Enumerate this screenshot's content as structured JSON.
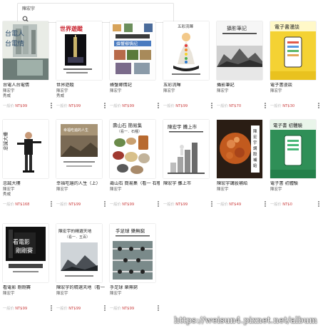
{
  "search": {
    "query": "陳宏宇",
    "icon": "search-icon"
  },
  "books": [
    {
      "title": "台電人台電情",
      "author": "陳宏宇",
      "publisher": "秀威",
      "price_label": "一般价",
      "price": "NT$99",
      "cover_text": [
        "台電人",
        "台電情"
      ]
    },
    {
      "title": "世界遊蹤",
      "author": "陳宏宇",
      "publisher": "秀威",
      "price_label": "一般价",
      "price": "NT$99",
      "cover_text": [
        "世界遊蹤"
      ]
    },
    {
      "title": "蜂蟹鄉情記",
      "author": "陳宏宇",
      "publisher": "",
      "price_label": "一般价",
      "price": "NT$99",
      "cover_text": [
        "蜂蟹鄉情記"
      ]
    },
    {
      "title": "五彩流暉",
      "author": "陳宏宇",
      "publisher": "",
      "price_label": "一般价",
      "price": "NT$99",
      "cover_text": [
        "五彩流暉"
      ]
    },
    {
      "title": "攝影筆記",
      "author": "陳宏宇",
      "publisher": "",
      "price_label": "一般价",
      "price": "NT$70",
      "cover_text": [
        "攝影筆記"
      ]
    },
    {
      "title": "電子書漫談",
      "author": "陳宏宇",
      "publisher": "",
      "price_label": "一般价",
      "price": "NT$30",
      "cover_text": [
        "電子書漫談"
      ]
    },
    {
      "title": "忠誠大樓",
      "author": "陳宏宇",
      "publisher": "秀威",
      "price_label": "一般价",
      "price": "NT$168",
      "cover_text": [
        "忠誠大樓"
      ]
    },
    {
      "title": "幸福吃遍的人生（上）",
      "author": "陳宏宇",
      "publisher": "",
      "price_label": "一般价",
      "price": "NT$99",
      "cover_text": [
        "幸福吃遍的人生"
      ]
    },
    {
      "title": "壽山石 簡易集（看一 石種）",
      "author": "陳宏宇",
      "publisher": "",
      "price_label": "一般价",
      "price": "NT$99",
      "cover_text": [
        "壽山石 簡易集",
        "（看一．石種）"
      ]
    },
    {
      "title": "陳宏宇 攤上市",
      "author": "",
      "publisher": "",
      "price_label": "一般价",
      "price": "NT$99",
      "cover_text": [
        "陳宏宇 攤上市"
      ]
    },
    {
      "title": "陳宏宇講股補給",
      "author": "陳宏宇",
      "publisher": "",
      "price_label": "一般价",
      "price": "NT$49",
      "cover_text": [
        "陳宏宇講股補給"
      ]
    },
    {
      "title": "電子書 初體驗",
      "author": "陳宏宇",
      "publisher": "",
      "price_label": "一般价",
      "price": "NT$0",
      "cover_text": [
        "電子書 初體驗"
      ]
    },
    {
      "title": "看電影 剛剛賽",
      "author": "陳宏宇",
      "publisher": "",
      "price_label": "一般价",
      "price": "NT$99",
      "cover_text": [
        "看電影",
        "剛剛賽"
      ]
    },
    {
      "title": "陳宏宇的精選天地（看一 五百）",
      "author": "陳宏宇",
      "publisher": "",
      "price_label": "一般价",
      "price": "NT$99",
      "cover_text": [
        "陳宏宇的精選天地",
        "（看一．五百）"
      ]
    },
    {
      "title": "手足球 樂無窮",
      "author": "陳宏宇",
      "publisher": "",
      "price_label": "一般价",
      "price": "NT$99",
      "cover_text": [
        "手足球 樂無窮"
      ]
    }
  ],
  "watermark": "https://weisun4.pixnet.net/album"
}
